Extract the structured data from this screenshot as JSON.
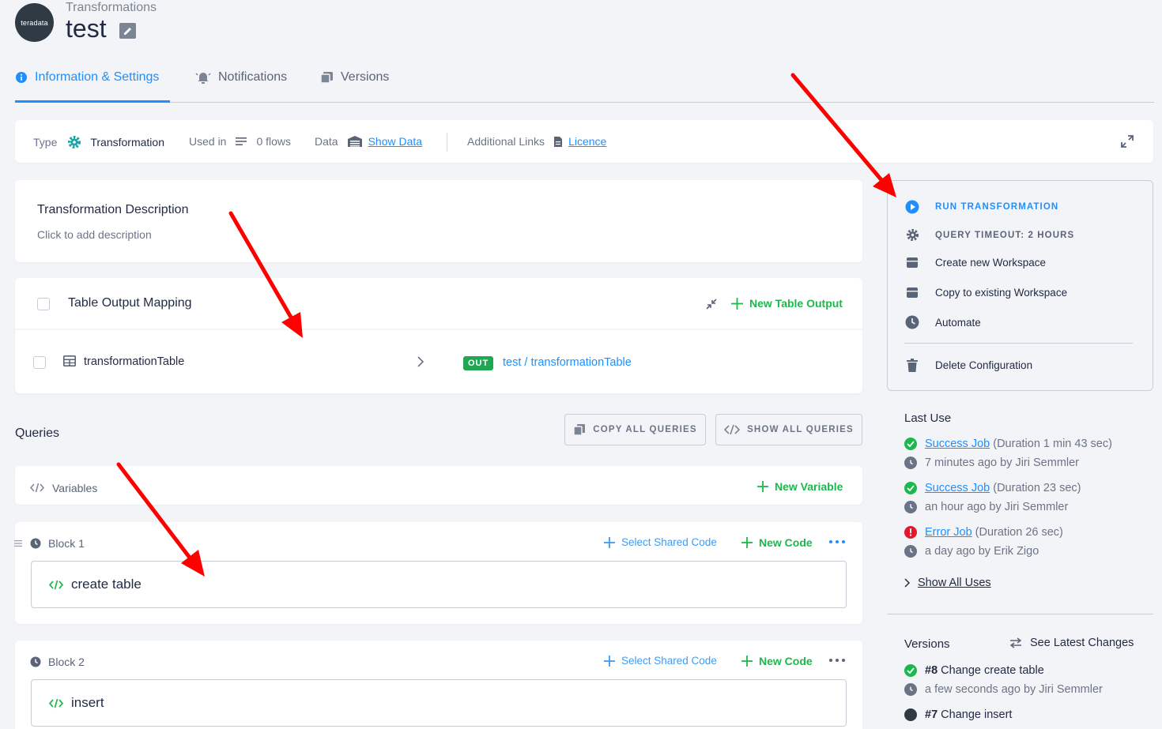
{
  "header": {
    "logo_text": "teradata",
    "breadcrumb": "Transformations",
    "title": "test"
  },
  "tabs": [
    {
      "label": "Information & Settings"
    },
    {
      "label": "Notifications"
    },
    {
      "label": "Versions"
    }
  ],
  "infobar": {
    "type_label": "Type",
    "type_value": "Transformation",
    "used_label": "Used in",
    "used_value": "0 flows",
    "data_label": "Data",
    "data_link": "Show Data",
    "links_label": "Additional Links",
    "links_link": "Licence"
  },
  "description": {
    "title": "Transformation Description",
    "placeholder": "Click to add description"
  },
  "table_output": {
    "title": "Table Output Mapping",
    "new_button": "New Table Output",
    "row": {
      "source": "transformationTable",
      "badge": "OUT",
      "destination": "test / transformationTable"
    }
  },
  "queries": {
    "title": "Queries",
    "copy_all": "COPY ALL QUERIES",
    "show_all": "SHOW ALL QUERIES",
    "variables_label": "Variables",
    "new_variable": "New Variable",
    "select_shared": "Select Shared Code",
    "new_code": "New Code",
    "blocks": [
      {
        "title": "Block 1",
        "code": "create table"
      },
      {
        "title": "Block 2",
        "code": "insert"
      }
    ]
  },
  "actions": {
    "run": "RUN TRANSFORMATION",
    "timeout": "QUERY TIMEOUT: 2 HOURS",
    "create_workspace": "Create new Workspace",
    "copy_workspace": "Copy to existing Workspace",
    "automate": "Automate",
    "delete": "Delete Configuration"
  },
  "last_use": {
    "title": "Last Use",
    "jobs": [
      {
        "link": "Success Job",
        "duration": "(Duration 1 min 43 sec)",
        "meta": "7 minutes ago by Jiri Semmler",
        "status": "success"
      },
      {
        "link": "Success Job",
        "duration": "(Duration 23 sec)",
        "meta": "an hour ago by Jiri Semmler",
        "status": "success"
      },
      {
        "link": "Error Job",
        "duration": "(Duration 26 sec)",
        "meta": "a day ago by Erik Zigo",
        "status": "error"
      }
    ],
    "show_all": "Show All Uses"
  },
  "versions": {
    "title": "Versions",
    "see_latest": "See Latest Changes",
    "items": [
      {
        "num": "#8",
        "desc": "Change create table",
        "meta": "a few seconds ago by Jiri Semmler"
      },
      {
        "num": "#7",
        "desc": "Change insert"
      }
    ]
  },
  "colors": {
    "accent": "#1f8fff",
    "success": "#1db84d",
    "error": "#e3172e",
    "annotation": "#ff0000"
  }
}
